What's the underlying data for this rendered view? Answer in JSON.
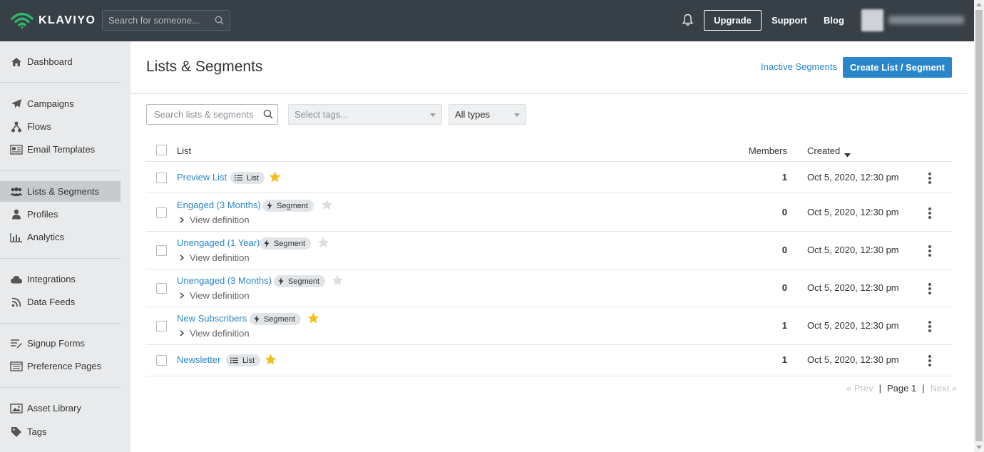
{
  "header": {
    "logo_text": "KLAVIYO",
    "search_placeholder": "Search for someone...",
    "upgrade_label": "Upgrade",
    "support_label": "Support",
    "blog_label": "Blog"
  },
  "sidebar": {
    "items": [
      {
        "label": "Dashboard",
        "icon": "home-icon"
      },
      {
        "label": "Campaigns",
        "icon": "paper-plane-icon"
      },
      {
        "label": "Flows",
        "icon": "flow-icon"
      },
      {
        "label": "Email Templates",
        "icon": "template-icon"
      },
      {
        "label": "Lists & Segments",
        "icon": "users-icon",
        "active": true
      },
      {
        "label": "Profiles",
        "icon": "user-icon"
      },
      {
        "label": "Analytics",
        "icon": "bar-chart-icon"
      },
      {
        "label": "Integrations",
        "icon": "cloud-icon"
      },
      {
        "label": "Data Feeds",
        "icon": "rss-icon"
      },
      {
        "label": "Signup Forms",
        "icon": "form-list-icon"
      },
      {
        "label": "Preference Pages",
        "icon": "preference-page-icon"
      },
      {
        "label": "Asset Library",
        "icon": "image-icon"
      },
      {
        "label": "Tags",
        "icon": "tag-icon"
      }
    ]
  },
  "page": {
    "title": "Lists & Segments",
    "inactive_link": "Inactive Segments",
    "create_button": "Create List / Segment"
  },
  "filters": {
    "search_placeholder": "Search lists & segments",
    "tags_placeholder": "Select tags...",
    "type_value": "All types"
  },
  "table": {
    "headers": {
      "list": "List",
      "members": "Members",
      "created": "Created"
    },
    "view_definition": "View definition",
    "rows": [
      {
        "name": "Preview List",
        "type": "List",
        "starred": true,
        "members": "1",
        "created": "Oct 5, 2020, 12:30 pm"
      },
      {
        "name": "Engaged (3 Months)",
        "type": "Segment",
        "starred": false,
        "members": "0",
        "created": "Oct 5, 2020, 12:30 pm"
      },
      {
        "name": "Unengaged (1 Year)",
        "type": "Segment",
        "starred": false,
        "members": "0",
        "created": "Oct 5, 2020, 12:30 pm"
      },
      {
        "name": "Unengaged (3 Months)",
        "type": "Segment",
        "starred": false,
        "members": "0",
        "created": "Oct 5, 2020, 12:30 pm"
      },
      {
        "name": "New Subscribers",
        "type": "Segment",
        "starred": true,
        "members": "1",
        "created": "Oct 5, 2020, 12:30 pm"
      },
      {
        "name": "Newsletter",
        "type": "List",
        "starred": true,
        "members": "1",
        "created": "Oct 5, 2020, 12:30 pm"
      }
    ]
  },
  "pagination": {
    "prev": "« Prev",
    "sep": "|",
    "page": "Page 1",
    "next": "Next »"
  },
  "colors": {
    "accent": "#2a86ca",
    "star_on": "#f2bf1c",
    "star_off": "#dcdfe2",
    "topbar": "#373f47",
    "logo_green": "#2fb866"
  }
}
